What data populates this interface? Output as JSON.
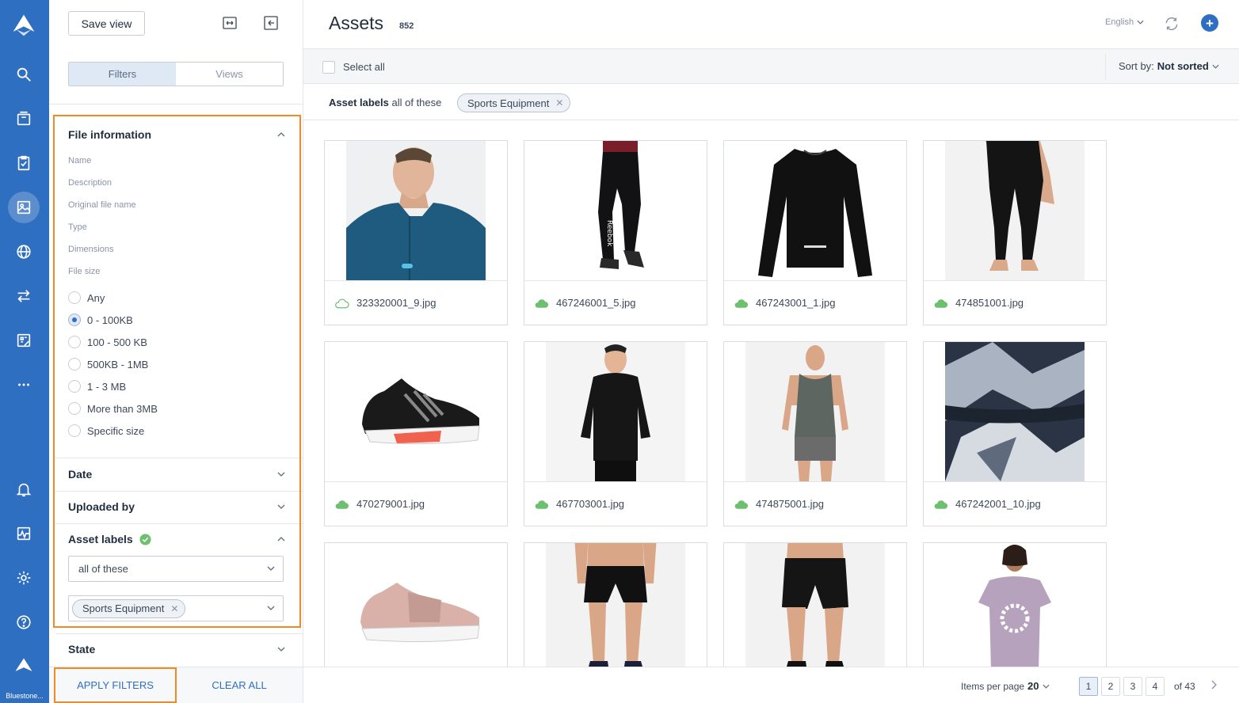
{
  "nav": {
    "brand": "Bluestone..."
  },
  "panel": {
    "save_view_label": "Save view",
    "tabs": [
      {
        "label": "Filters",
        "active": true
      },
      {
        "label": "Views",
        "active": false
      }
    ],
    "file_information": {
      "title": "File information",
      "fields": [
        "Name",
        "Description",
        "Original file name",
        "Type",
        "Dimensions",
        "File size"
      ],
      "size_options": [
        {
          "label": "Any",
          "selected": false
        },
        {
          "label": "0 - 100KB",
          "selected": true
        },
        {
          "label": "100 - 500 KB",
          "selected": false
        },
        {
          "label": "500KB - 1MB",
          "selected": false
        },
        {
          "label": "1 - 3 MB",
          "selected": false
        },
        {
          "label": "More than 3MB",
          "selected": false
        },
        {
          "label": "Specific size",
          "selected": false
        }
      ]
    },
    "date_title": "Date",
    "uploaded_by_title": "Uploaded by",
    "asset_labels": {
      "title": "Asset labels",
      "mode": "all of these",
      "chip": "Sports Equipment"
    },
    "state_title": "State",
    "apply_label": "APPLY FILTERS",
    "clear_label": "CLEAR ALL"
  },
  "header": {
    "title": "Assets",
    "count": "852",
    "language": "English"
  },
  "toolbar": {
    "select_all": "Select all",
    "sort_prefix": "Sort by:",
    "sort_value": "Not sorted"
  },
  "filterbar": {
    "label_bold": "Asset labels",
    "label_rest": "all of these",
    "chip": "Sports Equipment"
  },
  "assets": [
    {
      "file": "323320001_9.jpg",
      "image": "jacket-model",
      "synced": false
    },
    {
      "file": "467246001_5.jpg",
      "image": "jogger-pants",
      "synced": true
    },
    {
      "file": "467243001_1.jpg",
      "image": "longsleeve-top",
      "synced": true
    },
    {
      "file": "474851001.jpg",
      "image": "leggings",
      "synced": true
    },
    {
      "file": "470279001.jpg",
      "image": "running-shoe",
      "synced": true
    },
    {
      "file": "467703001.jpg",
      "image": "running-jacket",
      "synced": true
    },
    {
      "file": "474875001.jpg",
      "image": "tank-top",
      "synced": true
    },
    {
      "file": "467242001_10.jpg",
      "image": "printed-tights",
      "synced": true
    },
    {
      "file": "",
      "image": "pink-shoe",
      "synced": true
    },
    {
      "file": "",
      "image": "compression-shorts",
      "synced": true
    },
    {
      "file": "",
      "image": "training-shorts",
      "synced": true
    },
    {
      "file": "",
      "image": "graphic-tee",
      "synced": true
    }
  ],
  "pagination": {
    "items_label": "Items per page",
    "items_value": "20",
    "pages": [
      "1",
      "2",
      "3",
      "4"
    ],
    "current": "1",
    "of_total": "of 43"
  },
  "colors": {
    "nav": "#2f6fc1",
    "accent": "#2f6fc1",
    "highlight": "#f08a24",
    "synced": "#6cc070"
  }
}
